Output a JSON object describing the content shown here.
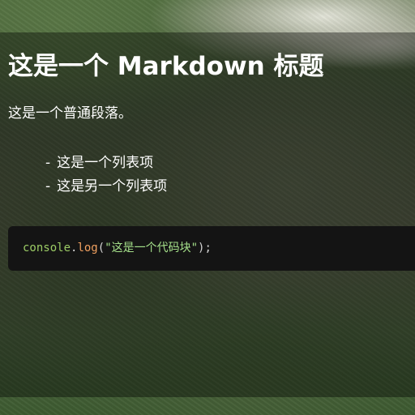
{
  "heading": "这是一个 Markdown 标题",
  "paragraph": "这是一个普通段落。",
  "list": {
    "marker": "-",
    "items": [
      "这是一个列表项",
      "这是另一个列表项"
    ]
  },
  "code": {
    "object": "console",
    "dot": ".",
    "method": "log",
    "open_paren": "(",
    "string": "\"这是一个代码块\"",
    "close": ");"
  },
  "colors": {
    "code_background": "#141414",
    "code_object": "#9ccc65",
    "code_method": "#f0a060",
    "code_string": "#a5e08a"
  }
}
